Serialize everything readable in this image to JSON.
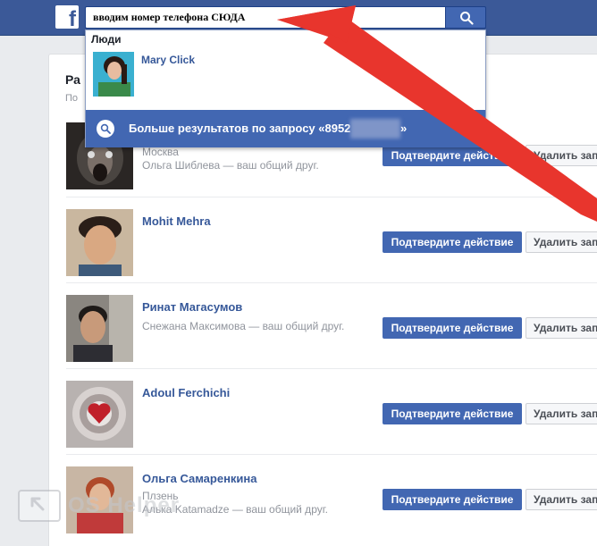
{
  "header": {
    "logo_letter": "f",
    "search_value": "вводим номер телефона СЮДА",
    "search_icon": "search-icon"
  },
  "dropdown": {
    "section_label": "Люди",
    "result_name": "Mary Click",
    "more_results_prefix": "Больше результатов по запросу «8952",
    "more_results_suffix": "»"
  },
  "page": {
    "title": "Ра",
    "subtitle": "По"
  },
  "friends": [
    {
      "name": "",
      "line1": "Москва",
      "line2": "Ольга Шиблева — ваш общий друг.",
      "confirm": "Подтвердите действие",
      "delete": "Удалить запрос"
    },
    {
      "name": "Mohit Mehra",
      "line1": "",
      "line2": "",
      "confirm": "Подтвердите действие",
      "delete": "Удалить запрос"
    },
    {
      "name": "Ринат Магасумов",
      "line1": "Снежана Максимова — ваш общий друг.",
      "line2": "",
      "confirm": "Подтвердите действие",
      "delete": "Удалить запрос"
    },
    {
      "name": "Adoul Ferchichi",
      "line1": "",
      "line2": "",
      "confirm": "Подтвердите действие",
      "delete": "Удалить запрос"
    },
    {
      "name": "Ольга Самаренкина",
      "line1": "Плзень",
      "line2": "Алька Katamadze — ваш общий друг.",
      "confirm": "Подтвердите действие",
      "delete": "Удалить запрос"
    }
  ],
  "watermark": "OS Helper",
  "colors": {
    "brand": "#3b5998",
    "button": "#4267b2",
    "arrow": "#e8352d"
  }
}
